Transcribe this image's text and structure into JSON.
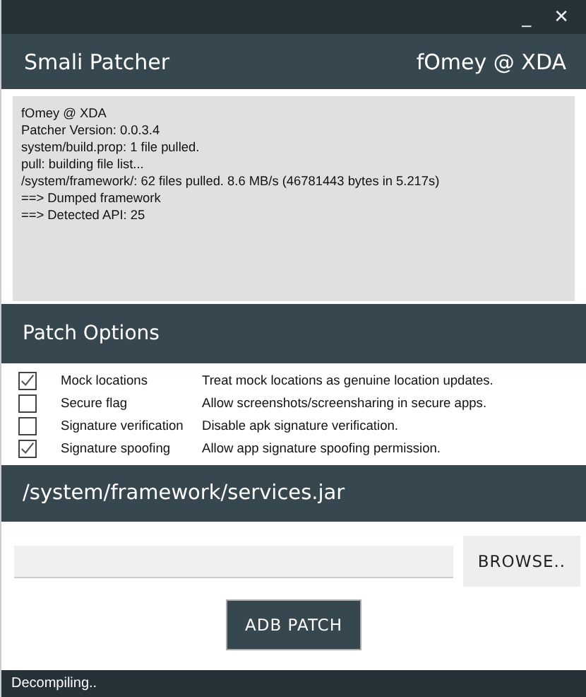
{
  "window": {
    "minimize": "_",
    "close": "✕"
  },
  "header": {
    "title": "Smali Patcher",
    "author": "fOmey @ XDA"
  },
  "log": [
    "fOmey @ XDA",
    "Patcher Version: 0.0.3.4",
    "system/build.prop: 1 file pulled.",
    "pull: building file list...",
    "/system/framework/: 62 files pulled. 8.6 MB/s (46781443 bytes in 5.217s)",
    "==> Dumped framework",
    "==> Detected API: 25"
  ],
  "patch_options": {
    "title": "Patch Options",
    "options": [
      {
        "label": "Mock locations",
        "description": "Treat mock locations as genuine location updates.",
        "checked": true
      },
      {
        "label": "Secure flag",
        "description": "Allow screenshots/screensharing in secure apps.",
        "checked": false
      },
      {
        "label": "Signature verification",
        "description": "Disable apk signature verification.",
        "checked": false
      },
      {
        "label": "Signature spoofing",
        "description": "Allow app signature spoofing permission.",
        "checked": true
      }
    ]
  },
  "file_section": {
    "title": "/system/framework/services.jar",
    "browse_button": "BROWSE..",
    "patch_button": "ADB PATCH"
  },
  "status_bar": "Decompiling.."
}
